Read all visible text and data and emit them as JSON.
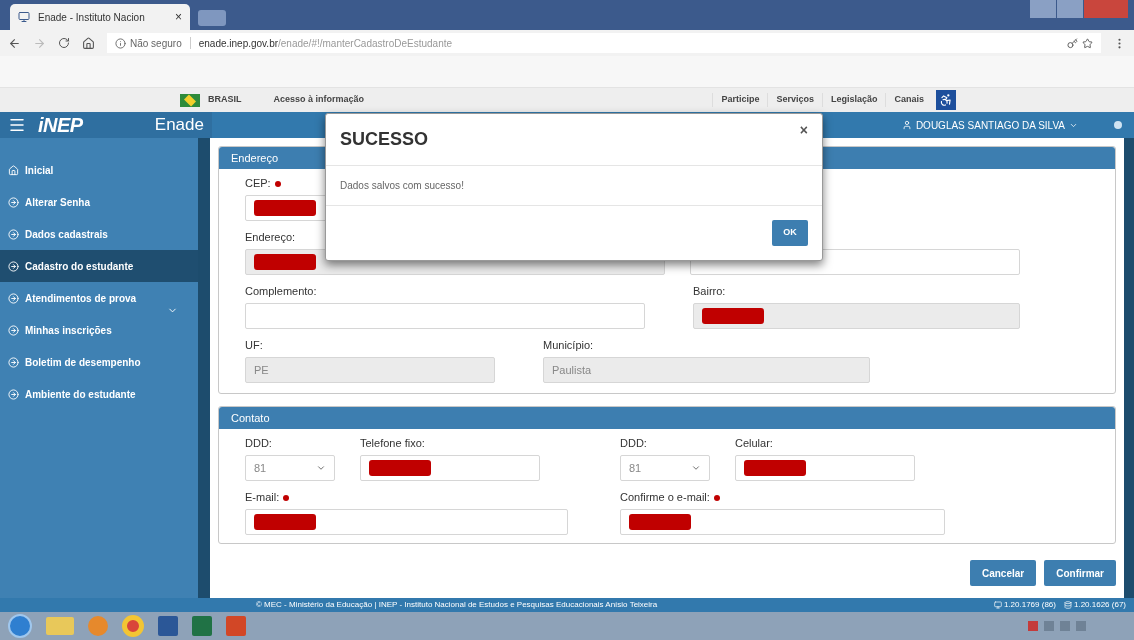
{
  "browser": {
    "tab": {
      "title": "Enade - Instituto Nacion",
      "close": "×"
    },
    "security": "Não seguro",
    "url_host": "enade.inep.gov.br",
    "url_path": "/enade/#!/manterCadastroDeEstudante"
  },
  "gov_bar": {
    "country": "BRASIL",
    "access": "Acesso à informação",
    "links": [
      "Participe",
      "Serviços",
      "Legislação",
      "Canais"
    ]
  },
  "header": {
    "logo": "iNEP",
    "app": "Enade",
    "user": "DOUGLAS SANTIAGO DA SILVA"
  },
  "sidebar": [
    {
      "label": "Inicial",
      "selected": false,
      "submenu": false
    },
    {
      "label": "Alterar Senha",
      "selected": false,
      "submenu": false
    },
    {
      "label": "Dados cadastrais",
      "selected": false,
      "submenu": false
    },
    {
      "label": "Cadastro do estudante",
      "selected": true,
      "submenu": false
    },
    {
      "label": "Atendimentos de prova",
      "selected": false,
      "submenu": true
    },
    {
      "label": "Minhas inscrições",
      "selected": false,
      "submenu": false
    },
    {
      "label": "Boletim de desempenho",
      "selected": false,
      "submenu": false
    },
    {
      "label": "Ambiente do estudante",
      "selected": false,
      "submenu": false
    }
  ],
  "address_panel": {
    "title": "Endereço",
    "rows": [
      [
        {
          "kind": "text",
          "label": "CEP:",
          "required": true,
          "redacted": true,
          "disabled": false
        }
      ],
      [
        {
          "kind": "text",
          "label": "Endereço:",
          "required": false,
          "redacted": true,
          "disabled": true
        },
        {
          "kind": "text",
          "redacted": false,
          "disabled": false
        }
      ],
      [
        {
          "kind": "text",
          "label": "Complemento:",
          "required": false,
          "redacted": false,
          "disabled": false
        },
        {
          "kind": "text",
          "label": "Bairro:",
          "required": false,
          "redacted": true,
          "disabled": true
        }
      ],
      [
        {
          "kind": "text",
          "label": "UF:",
          "required": false,
          "redacted": false,
          "disabled": true,
          "value": "PE"
        },
        {
          "kind": "text",
          "label": "Município:",
          "required": false,
          "redacted": false,
          "disabled": true,
          "value": "Paulista"
        }
      ]
    ]
  },
  "contact_panel": {
    "title": "Contato",
    "rows": [
      [
        {
          "kind": "select",
          "label": "DDD:",
          "required": false,
          "redacted": false,
          "disabled": false,
          "value": "81"
        },
        {
          "kind": "text",
          "label": "Telefone fixo:",
          "required": false,
          "redacted": true,
          "disabled": false
        },
        {
          "kind": "select",
          "label": "DDD:",
          "required": false,
          "redacted": false,
          "disabled": false,
          "value": "81"
        },
        {
          "kind": "text",
          "label": "Celular:",
          "required": false,
          "redacted": true,
          "disabled": false
        }
      ],
      [
        {
          "kind": "text",
          "label": "E-mail:",
          "required": true,
          "redacted": true,
          "disabled": false
        },
        "",
        {
          "kind": "text",
          "label": "Confirme o e-mail:",
          "required": true,
          "redacted": true,
          "disabled": false
        },
        ""
      ]
    ]
  },
  "actions": [
    "Cancelar",
    "Confirmar"
  ],
  "modal": {
    "title": "SUCESSO",
    "close": "×",
    "message": "Dados salvos com sucesso!",
    "button": "OK"
  },
  "footer": {
    "text": "© MEC - Ministério da Educação | INEP - Instituto Nacional de Estudos e Pesquisas Educacionais Anísio Teixeira",
    "versions": [
      "1.20.1769 (86)",
      "1.20.1626 (67)"
    ]
  }
}
